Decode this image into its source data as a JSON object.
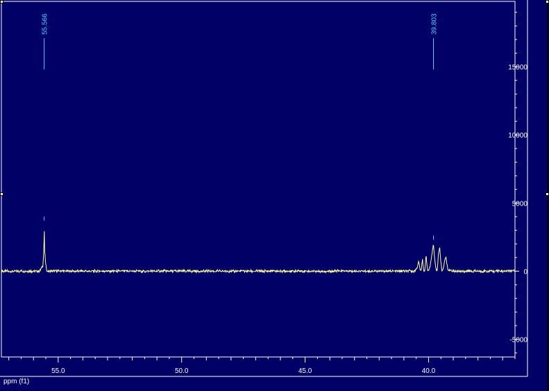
{
  "chart_data": {
    "type": "line",
    "xlabel": "ppm (f1)",
    "ylabel": "",
    "x_reversed": true,
    "xlim": [
      57.3,
      36.5
    ],
    "ylim": [
      -6300,
      19800
    ],
    "x_ticks": [
      {
        "value": 55.0,
        "label": "55.0"
      },
      {
        "value": 50.0,
        "label": "50.0"
      },
      {
        "value": 45.0,
        "label": "45.0"
      },
      {
        "value": 40.0,
        "label": "40.0"
      }
    ],
    "y_ticks": [
      {
        "value": 15000,
        "label": "15000"
      },
      {
        "value": 10000,
        "label": "10000"
      },
      {
        "value": 5000,
        "label": "5000"
      },
      {
        "value": 0,
        "label": "0"
      },
      {
        "value": -5000,
        "label": "-5000"
      }
    ],
    "peaks": [
      {
        "label": "55.566",
        "ppm": 55.566,
        "height": 3400
      },
      {
        "label": "39.803",
        "ppm": 39.803,
        "height": 2000
      }
    ],
    "series": [
      {
        "x": [
          55.75,
          55.62,
          55.58,
          55.566,
          55.55,
          55.5,
          55.45,
          40.55,
          40.45,
          40.4,
          40.35,
          40.3,
          40.25,
          40.2,
          40.15,
          40.1,
          40.05,
          40.0,
          39.95,
          39.9,
          39.85,
          39.803,
          39.75,
          39.7,
          39.65,
          39.6,
          39.55,
          39.5,
          39.45,
          39.4,
          39.35,
          39.3,
          39.25,
          39.2,
          39.15,
          39.1
        ],
        "y": [
          0,
          400,
          1500,
          3400,
          1500,
          400,
          0,
          0,
          350,
          700,
          200,
          0,
          900,
          100,
          0,
          1200,
          200,
          0,
          300,
          700,
          1400,
          2000,
          900,
          100,
          0,
          1300,
          1800,
          600,
          0,
          200,
          800,
          1100,
          400,
          0,
          150,
          0
        ]
      }
    ],
    "colors": {
      "background": "#000066",
      "trace": "#ffff99",
      "peak_label": "#4fd0ff",
      "axis": "#ffffff"
    }
  }
}
